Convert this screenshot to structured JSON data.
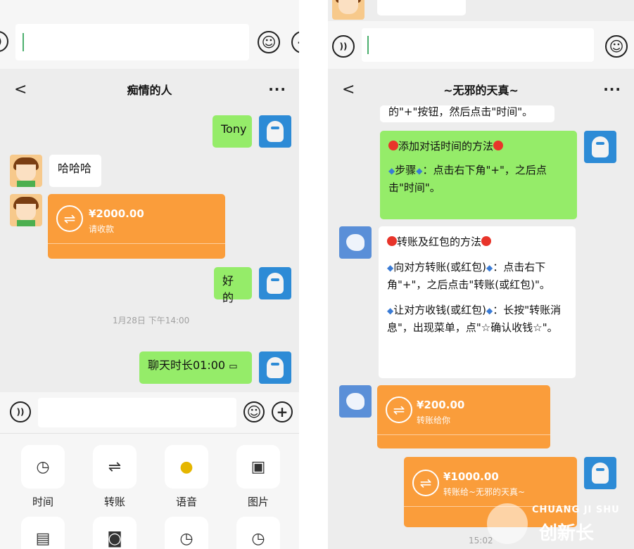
{
  "left": {
    "title": "痴情的人",
    "messages": {
      "tony": "Tony",
      "hahaha": "哈哈哈",
      "ok": "好的",
      "duration": "聊天时长01:00"
    },
    "transfer": {
      "amount": "¥2000.00",
      "note": "请收款"
    },
    "timestamp": "1月28日 下午14:00",
    "tools": [
      {
        "label": "时间",
        "icon": "clock-icon"
      },
      {
        "label": "转账",
        "icon": "transfer-icon"
      },
      {
        "label": "语音",
        "icon": "microphone-icon"
      },
      {
        "label": "图片",
        "icon": "image-icon"
      }
    ]
  },
  "right": {
    "title": "~无邪的天真~",
    "top_partial": "的\"+\"按钮，然后点击\"时间\"。",
    "msg1": {
      "heading": "添加对话时间的方法",
      "step_label": "步骤",
      "step_text": "：点击右下角\"+\"，之后点击\"时间\"。"
    },
    "msg2": {
      "heading": "转账及红包的方法",
      "p1_label": "向对方转账(或红包)",
      "p1_text": "：点击右下角\"+\"，之后点击\"转账(或红包)\"。",
      "p2_label": "让对方收钱(或红包)",
      "p2_text": "：长按\"转账消息\"，出现菜单，点\"☆确认收钱☆\"。"
    },
    "transfer1": {
      "amount": "¥200.00",
      "note": "转账给你"
    },
    "transfer2": {
      "amount": "¥1000.00",
      "note": "转账给~无邪的天真~"
    },
    "time_partial": "15:02"
  },
  "watermark": {
    "text_en": "CHUANG JI SHU",
    "text_cn": "创新长"
  }
}
